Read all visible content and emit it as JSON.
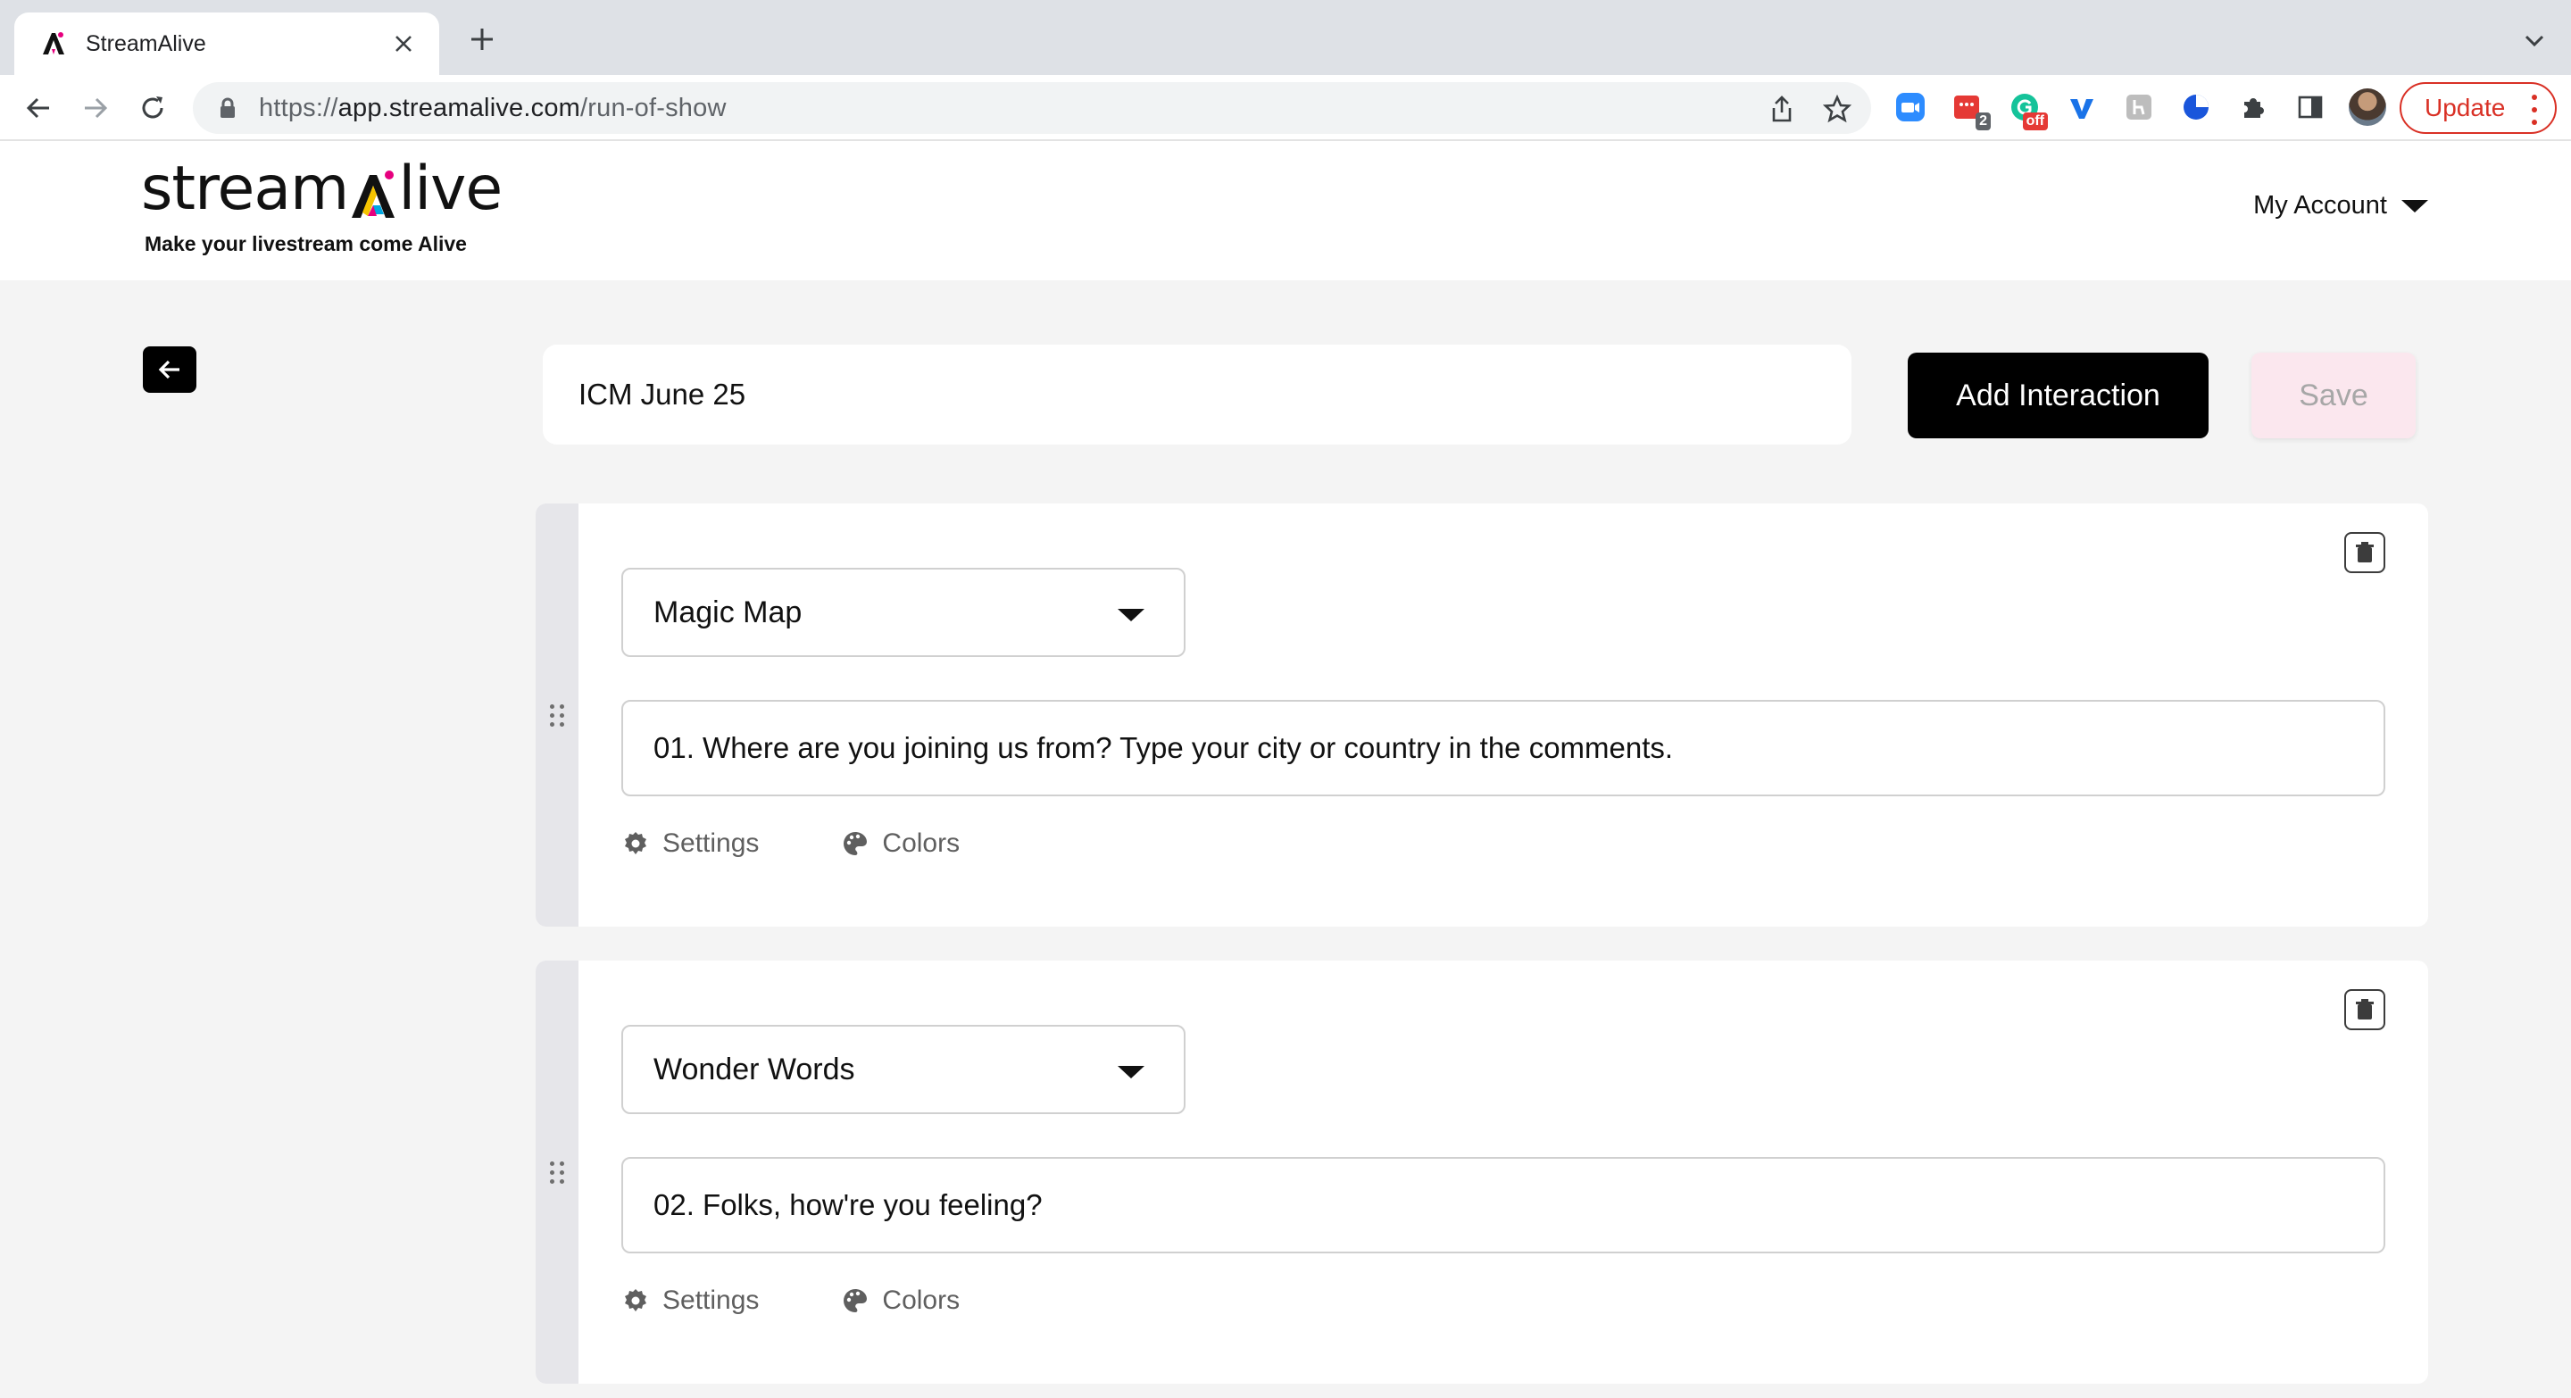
{
  "browser": {
    "tab_title": "StreamAlive",
    "url_scheme": "https://",
    "url_host": "app.streamalive.com",
    "url_path": "/run-of-show",
    "extension_badges": {
      "red_ext": "2",
      "green_ext": "off"
    },
    "update_label": "Update"
  },
  "header": {
    "logo_left": "stream",
    "logo_right": "live",
    "tagline": "Make your livestream come Alive",
    "account_label": "My Account"
  },
  "editor": {
    "show_title": "ICM June 25",
    "add_label": "Add Interaction",
    "save_label": "Save"
  },
  "interactions": [
    {
      "type": "Magic Map",
      "question": "01. Where are you joining us from? Type your city or country in the comments.",
      "settings_label": "Settings",
      "colors_label": "Colors"
    },
    {
      "type": "Wonder Words",
      "question": "02. Folks, how're you feeling?",
      "settings_label": "Settings",
      "colors_label": "Colors"
    }
  ],
  "colors": {
    "brand_black": "#000000",
    "save_disabled_bg": "#fbe7ee",
    "logo_accent_pink": "#e6007e",
    "update_red": "#d93025"
  }
}
